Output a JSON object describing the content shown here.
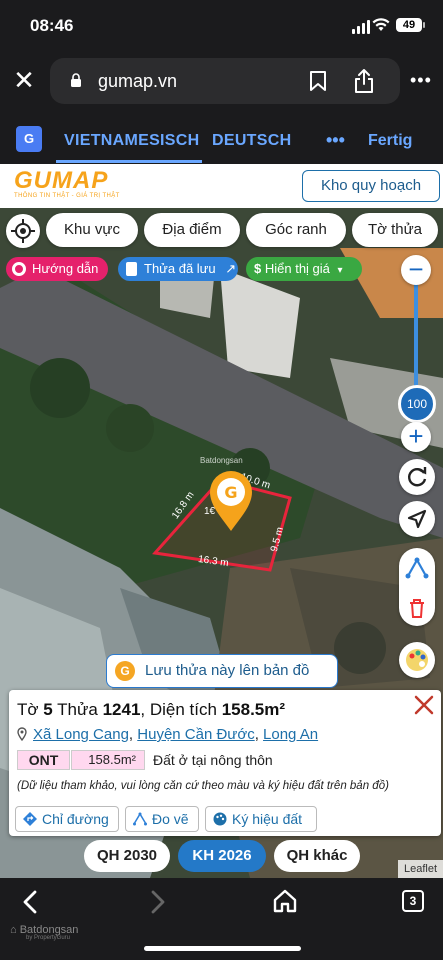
{
  "status_bar": {
    "time": "08:46",
    "battery": "49"
  },
  "browser": {
    "domain": "gumap.vn"
  },
  "translate_bar": {
    "language_1": "VIETNAMESISCH",
    "language_2": "DEUTSCH",
    "more": "•••",
    "done": "Fertig",
    "icon_letter": "G"
  },
  "header": {
    "logo": "GUMAP",
    "logo_tagline": "THÔNG TIN THẬT - GIÁ TRỊ THẬT",
    "planning_button": "Kho quy hoạch"
  },
  "map_toolbar": {
    "chips": [
      "Khu vực",
      "Địa điểm",
      "Góc ranh",
      "Tờ thửa"
    ]
  },
  "filters": {
    "guide": "Hướng dẫn",
    "saved_plots": "Thửa đã lưu",
    "show_price": "Hiển thị giá"
  },
  "map_controls": {
    "zoom_in": "+",
    "zoom_out": "−",
    "zoom_level": "100"
  },
  "plot": {
    "edge_labels": [
      "10.0 m",
      "9.5 m",
      "16.3 m",
      "16.8 m",
      "1€"
    ],
    "watermark": "Batdongsan",
    "marker_letter": "G"
  },
  "save_button": {
    "label": "Lưu thửa này lên bản đồ",
    "icon_letter": "G"
  },
  "info_card": {
    "sheet_prefix": "Tờ",
    "sheet": "5",
    "plot_prefix": "Thửa",
    "plot": "1241",
    "area_prefix": ", Diện tích",
    "area": "158.5m²",
    "commune": "Xã Long Cang",
    "district": "Huyện Cần Đước",
    "province": "Long An",
    "sep": ",",
    "land_code": "ONT",
    "land_area": "158.5m²",
    "land_use": "Đất ở tại nông thôn",
    "note": "(Dữ liệu tham khảo, vui lòng căn cứ theo màu và ký hiệu đất trên bản đồ)",
    "buttons": [
      "Chỉ đường",
      "Đo vẽ",
      "Ký hiệu đất"
    ]
  },
  "plan_tabs": [
    "QH 2030",
    "KH 2026",
    "QH khác"
  ],
  "attribution": "Leaflet",
  "bottom_bar": {
    "tab_count": "3",
    "brand": "Batdongsan",
    "brand_sub": "by PropertyGuru"
  },
  "colors": {
    "accent_blue": "#1d6fa9",
    "gumap_orange": "#f6a31b",
    "plot_outline": "#e8243c",
    "land_pink": "#ffd8ef"
  }
}
